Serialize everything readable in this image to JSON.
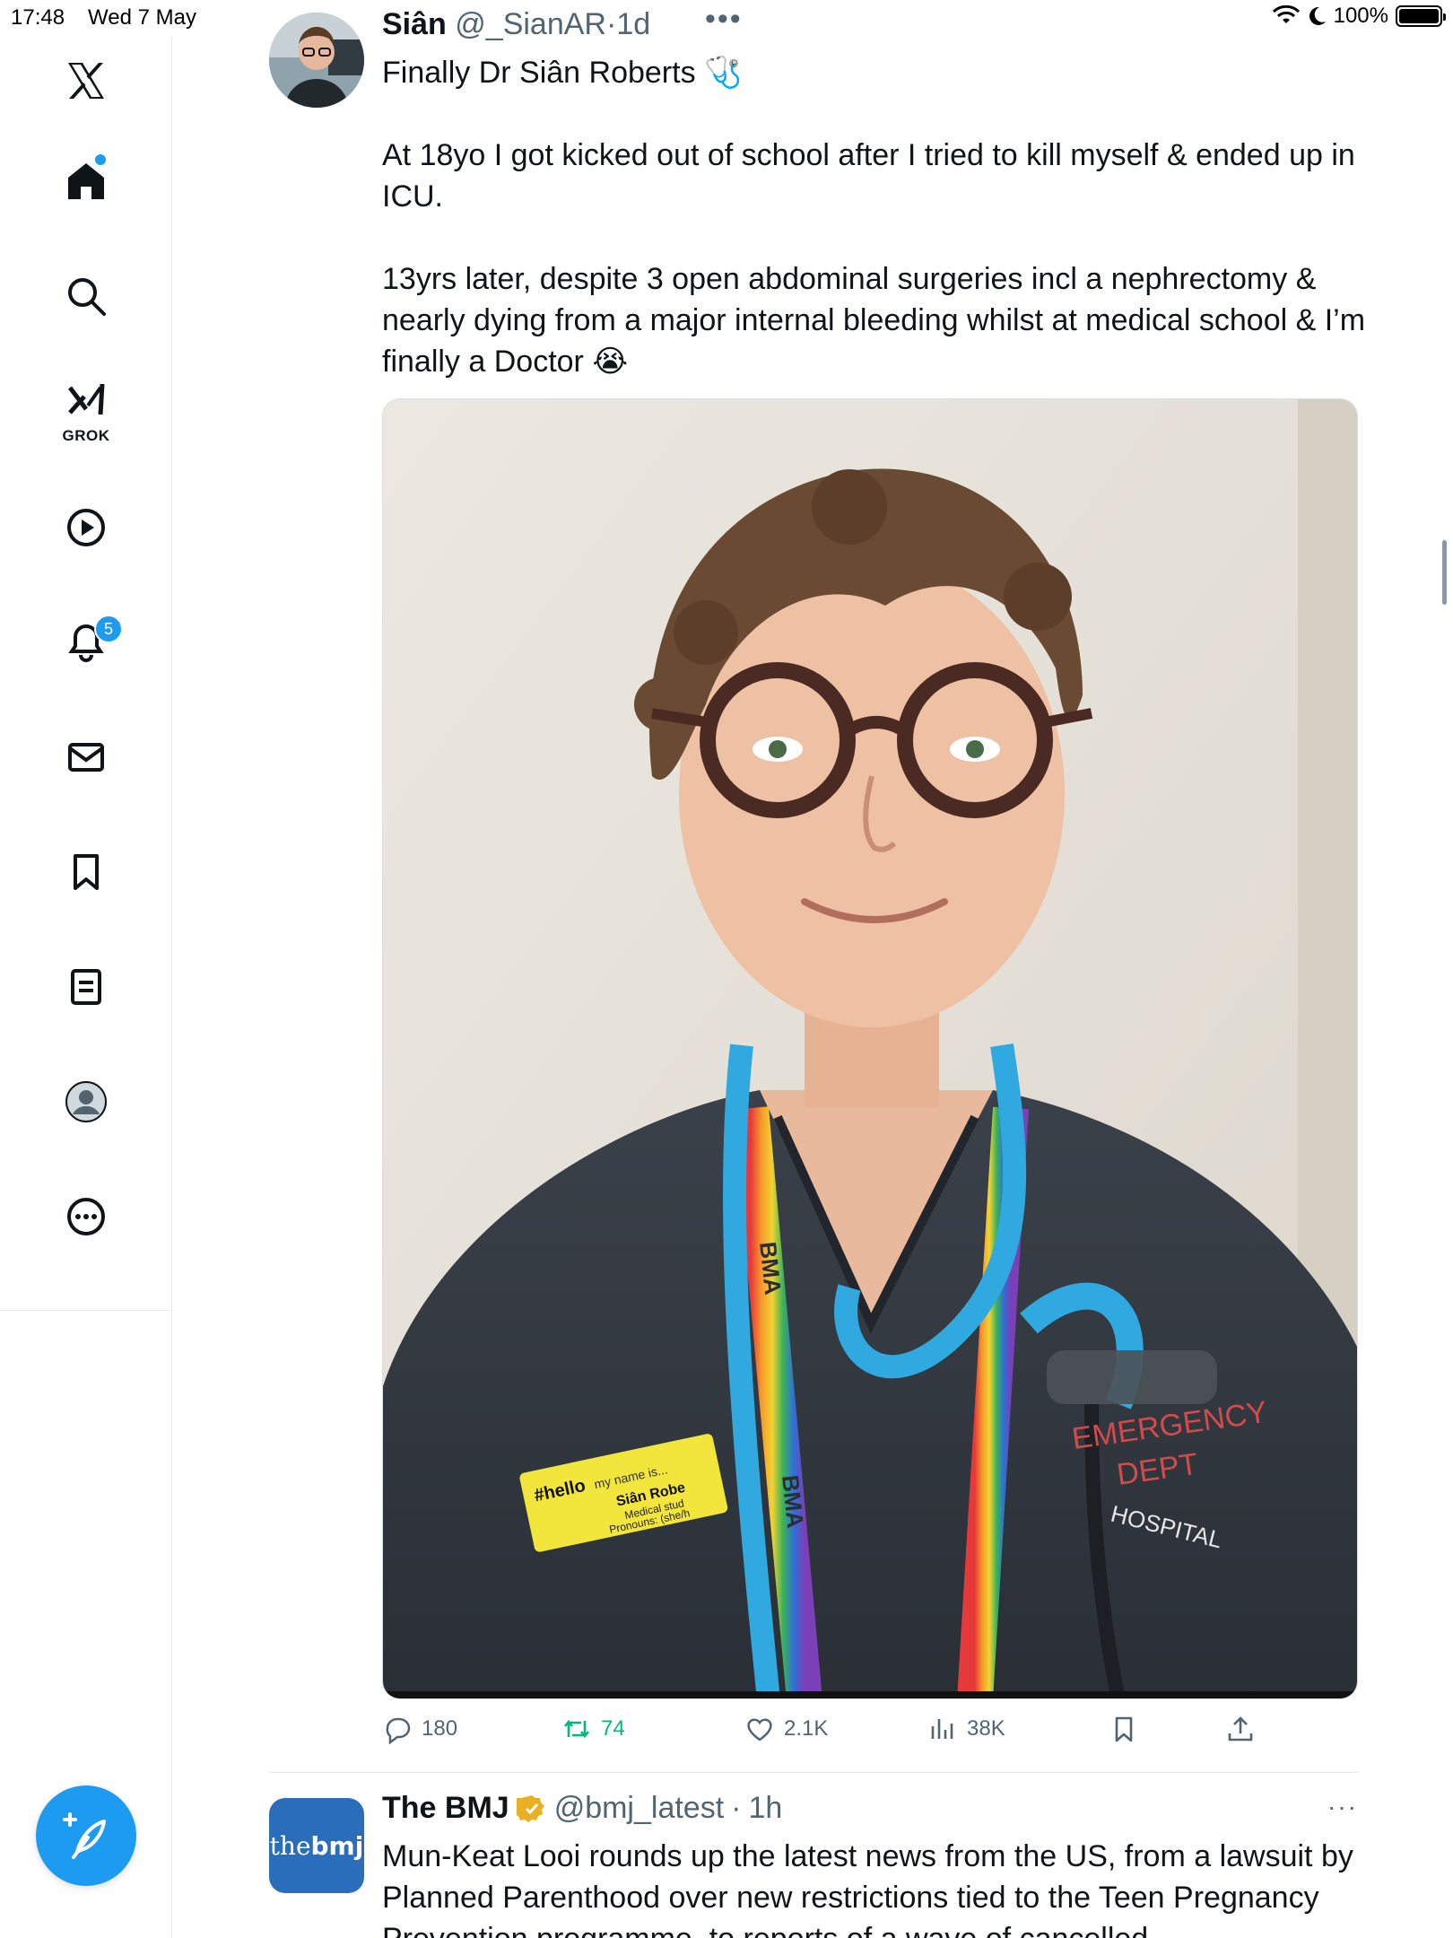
{
  "status_bar": {
    "time": "17:48",
    "date": "Wed 7 May",
    "battery": "100%"
  },
  "sidebar": {
    "items": [
      {
        "name": "x-logo"
      },
      {
        "name": "home"
      },
      {
        "name": "search"
      },
      {
        "name": "grok",
        "label": "GROK"
      },
      {
        "name": "video"
      },
      {
        "name": "notifications",
        "badge": "5"
      },
      {
        "name": "messages"
      },
      {
        "name": "bookmarks"
      },
      {
        "name": "articles"
      },
      {
        "name": "profile"
      },
      {
        "name": "more"
      }
    ],
    "accent": "#1d9bf0"
  },
  "tweet": {
    "display_name": "Siân",
    "handle": "@_SianAR",
    "sep": "·",
    "time": "1d",
    "more": "•••",
    "text": "Finally Dr Siân Roberts 🩺\n\nAt 18yo I got kicked out of school after I tried to kill myself & ended up in ICU.\n\n13yrs later, despite 3 open abdominal surgeries incl a nephrectomy & nearly dying from a major internal bleeding whilst at medical school & I’m finally a Doctor 😭",
    "media": {
      "badge_hello": "#hello",
      "badge_mynameis": "my name is...",
      "badge_name": "Siân Robe",
      "badge_role": "Medical stud",
      "badge_pronouns": "Pronouns: (she/h",
      "lanyard": "BMA",
      "scrub_text_1": "EMERGENCY",
      "scrub_text_2": "DEPT",
      "scrub_text_3": "HOSPITAL"
    },
    "actions": {
      "replies": "180",
      "reposts": "74",
      "likes": "2.1K",
      "views": "38K"
    }
  },
  "tweet2": {
    "display_name": "The BMJ",
    "handle": "@bmj_latest",
    "sep": "·",
    "time": "1h",
    "avatar_the": "the",
    "avatar_bmj": "bmj",
    "more": "···",
    "text": "Mun-Keat Looi rounds up the latest news from the US, from a lawsuit by Planned Parenthood over new restrictions tied to the Teen Pregnancy Prevention programme, to reports of a wave of cancelled"
  },
  "colors": {
    "text": "#0f1419",
    "secondary": "#536471",
    "repost_green": "#00ba7c",
    "brand_blue": "#1d9bf0"
  }
}
